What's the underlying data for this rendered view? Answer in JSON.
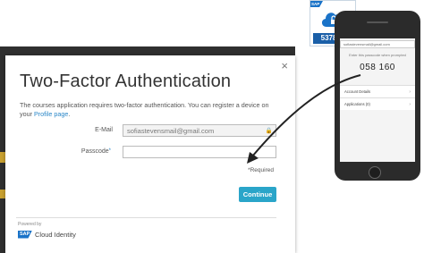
{
  "dialog": {
    "title": "Two-Factor Authentication",
    "description_prefix": "The courses application requires two-factor authentication. You can register a device on your ",
    "profile_link": "Profile page",
    "description_suffix": ".",
    "close_symbol": "×",
    "email_label": "E-Mail",
    "email_value": "sofiastevensmail@gmail.com",
    "passcode_label": "Passcode",
    "required_marker": "*",
    "required_note": "*Required",
    "continue_label": "Continue",
    "powered_by": "Powered by",
    "brand_logo": "SAP",
    "brand_name": "Cloud Identity"
  },
  "authenticator_badge": {
    "logo": "SAP",
    "code": "537810",
    "icon": "cloud-lock-icon"
  },
  "phone": {
    "address": "sofiastevensmail@gmail.com",
    "prompt": "Enter this passcode when prompted",
    "otp": "058 160",
    "rows": [
      {
        "label": "Account Details"
      },
      {
        "label": "Applications (0)"
      }
    ]
  },
  "colors": {
    "accent": "#2aa5c9",
    "link": "#2a87c8",
    "sap_blue": "#1a73c8",
    "badge_code_bg": "#1a5fa8"
  }
}
